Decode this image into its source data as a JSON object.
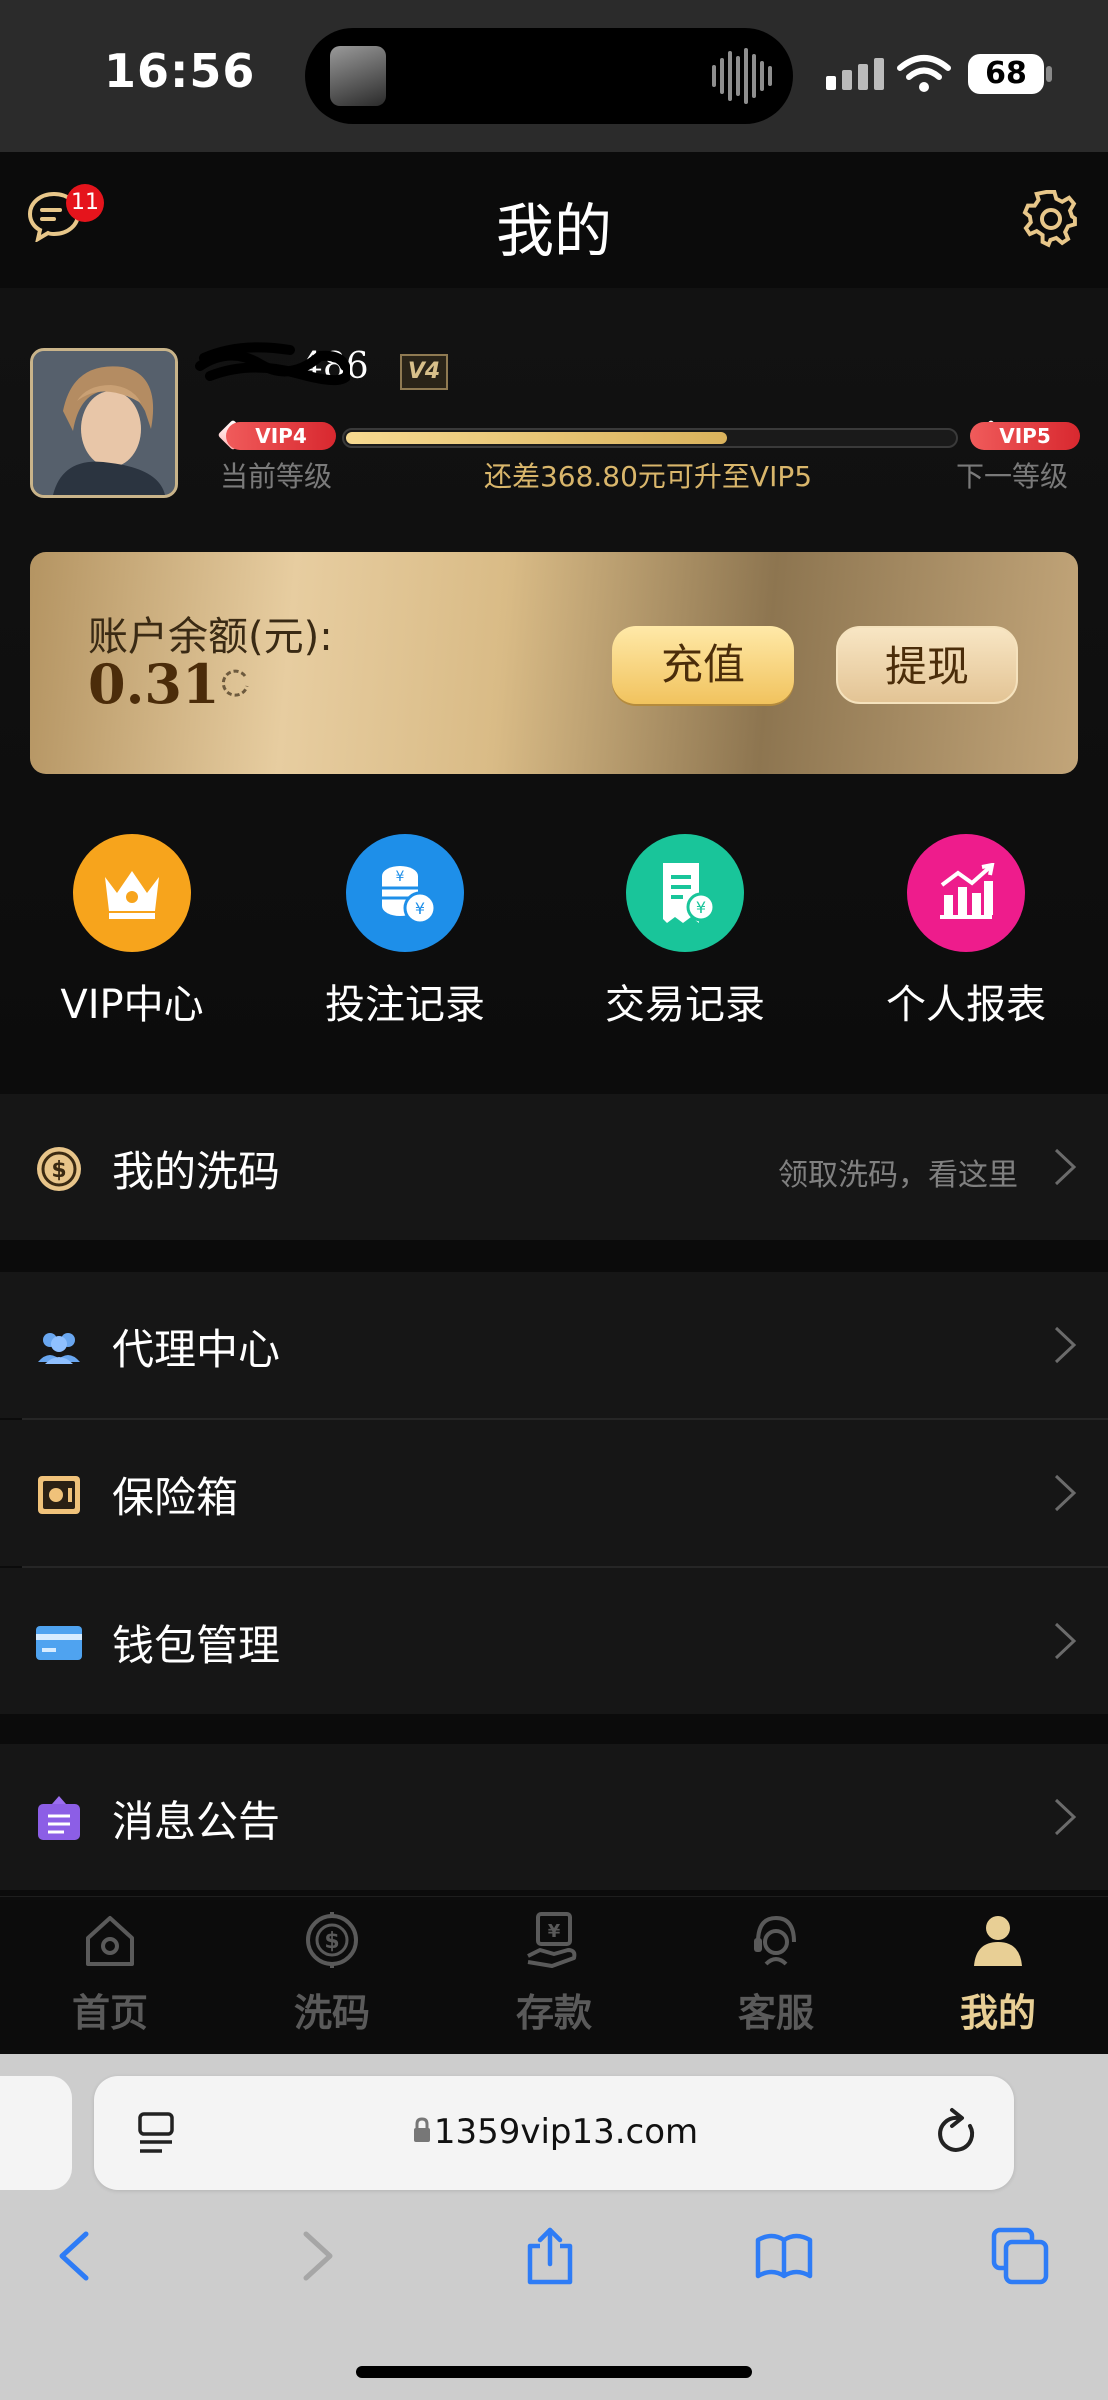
{
  "status_bar": {
    "time": "16:56",
    "battery": "68"
  },
  "header": {
    "title": "我的",
    "message_badge": "11"
  },
  "profile": {
    "username": "486",
    "level_badge": "V4",
    "current_vip": "VIP4",
    "next_vip": "VIP5",
    "current_level_label": "当前等级",
    "next_level_label": "下一等级",
    "upgrade_text": "还差368.80元可升至VIP5",
    "progress_fraction": 0.63
  },
  "balance": {
    "label": "账户余额(元):",
    "value": "0.31",
    "recharge_label": "充值",
    "withdraw_label": "提现"
  },
  "shortcuts": [
    {
      "label": "VIP中心",
      "icon": "crown-icon",
      "color": "#f7a41c"
    },
    {
      "label": "投注记录",
      "icon": "coins-icon",
      "color": "#1e8fe9"
    },
    {
      "label": "交易记录",
      "icon": "receipt-icon",
      "color": "#19c59a"
    },
    {
      "label": "个人报表",
      "icon": "chart-icon",
      "color": "#ee1c8c"
    }
  ],
  "menu": {
    "rebate": {
      "label": "我的洗码",
      "hint": "领取洗码，看这里"
    },
    "agent": {
      "label": "代理中心"
    },
    "safe": {
      "label": "保险箱"
    },
    "wallet": {
      "label": "钱包管理"
    },
    "notice": {
      "label": "消息公告"
    }
  },
  "tabbar": [
    {
      "label": "首页",
      "icon": "home-icon"
    },
    {
      "label": "洗码",
      "icon": "dollar-target-icon"
    },
    {
      "label": "存款",
      "icon": "deposit-icon"
    },
    {
      "label": "客服",
      "icon": "support-icon"
    },
    {
      "label": "我的",
      "icon": "user-icon",
      "active": true
    }
  ],
  "browser": {
    "url": "1359vip13.com"
  },
  "colors": {
    "gold": "#d9b66b",
    "tab_active": "#e8cf95",
    "badge_red": "#e5141c"
  }
}
